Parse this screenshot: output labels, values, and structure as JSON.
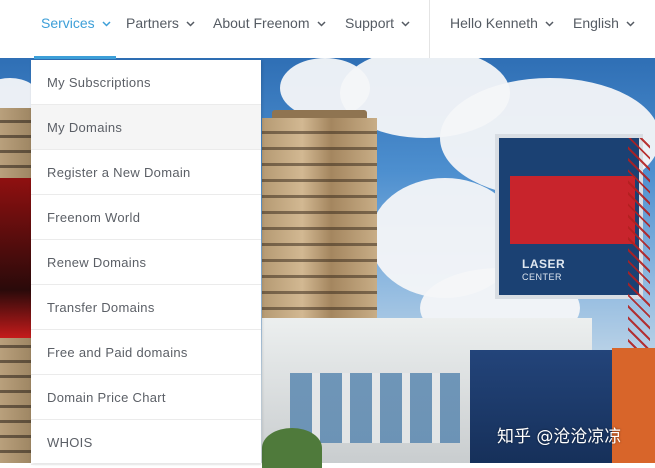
{
  "nav": {
    "items": [
      {
        "label": "Services",
        "active": true
      },
      {
        "label": "Partners"
      },
      {
        "label": "About Freenom"
      },
      {
        "label": "Support"
      }
    ],
    "user": {
      "label": "Hello Kenneth"
    },
    "language": {
      "label": "English"
    },
    "accent_color": "#3d9fd8"
  },
  "dropdown": {
    "items": [
      {
        "label": "My Subscriptions"
      },
      {
        "label": "My Domains",
        "hovered": true
      },
      {
        "label": "Register a New Domain"
      },
      {
        "label": "Freenom World"
      },
      {
        "label": "Renew Domains"
      },
      {
        "label": "Transfer Domains"
      },
      {
        "label": "Free and Paid domains"
      },
      {
        "label": "Domain Price Chart"
      },
      {
        "label": "WHOIS"
      }
    ]
  },
  "hero": {
    "billboard_text": "LASER",
    "billboard_sub": "CENTER"
  },
  "watermark": "知乎 @沧沧凉凉",
  "icons": {
    "dropdown_indicator": "chevron-down-icon"
  }
}
